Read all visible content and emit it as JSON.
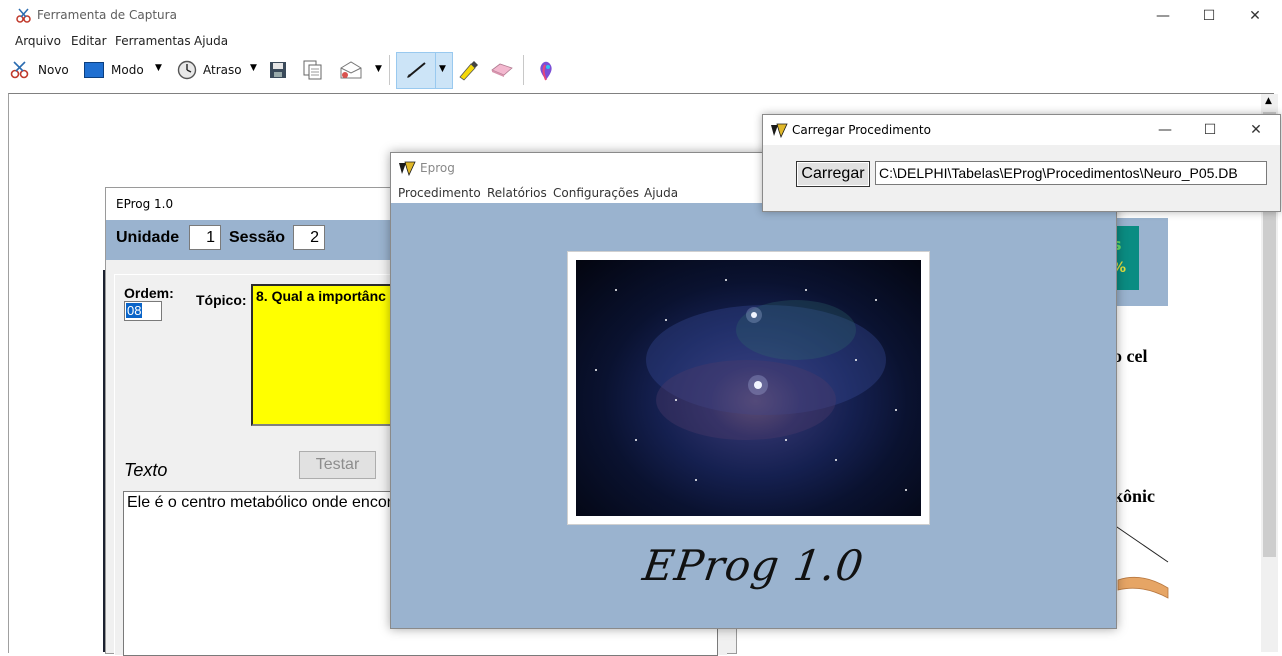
{
  "snip": {
    "title": "Ferramenta de Captura",
    "menu": [
      "Arquivo",
      "Editar",
      "Ferramentas",
      "Ajuda"
    ],
    "toolbar": {
      "novo": "Novo",
      "modo": "Modo",
      "atraso": "Atraso"
    }
  },
  "eprog_form": {
    "title": "EProg 1.0",
    "unidade_label": "Unidade",
    "unidade_value": "1",
    "sessao_label": "Sessão",
    "sessao_value": "2",
    "ordem_label": "Ordem:",
    "ordem_value": "08",
    "topico_label": "Tópico:",
    "topico_text": "8. Qual a importânc",
    "texto_label": "Texto",
    "testar_label": "Testar",
    "texto_content": "Ele é o centro metabólico onde encont citoplasmáticas."
  },
  "background_right": {
    "teal_text_1": "s",
    "teal_text_2": "%",
    "fragment_1": "o cel",
    "fragment_2": "kônic"
  },
  "eprog_splash": {
    "title": "Eprog",
    "menu": [
      "Procedimento",
      "Relatórios",
      "Configurações",
      "Ajuda"
    ],
    "brand": "EProg 1.0"
  },
  "carregar_dialog": {
    "title": "Carregar Procedimento",
    "button_label": "Carregar",
    "path_value": "C:\\DELPHI\\Tabelas\\EProg\\Procedimentos\\Neuro_P05.DB"
  },
  "colors": {
    "panel_blue": "#9ab3cf",
    "topico_yellow": "#ffff00",
    "teal": "#0a8c82"
  }
}
